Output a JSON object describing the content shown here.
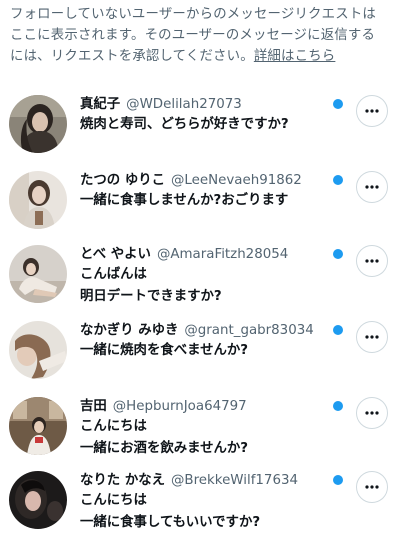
{
  "notice": {
    "line1": "フォローしていないユーザーからのメッセージリクエストは",
    "line2": "ここに表示されます。そのユーザーのメッセージに返信する",
    "line3": "には、リクエストを承認してください。",
    "link": "詳細はこちら"
  },
  "colors": {
    "unread_dot": "#1d9bf0",
    "secondary_text": "#536471"
  },
  "requests": [
    {
      "name": "真紀子",
      "handle": "@WDelilah27073",
      "messages": [
        "焼肉と寿司、どちらが好きですか?"
      ],
      "unread": true,
      "more_icon": "more-horizontal-icon",
      "avatar": "profile-photo"
    },
    {
      "name": "たつの ゆりこ",
      "handle": "@LeeNevaeh91862",
      "messages": [
        "一緒に食事しませんか?おごります"
      ],
      "unread": true,
      "more_icon": "more-horizontal-icon",
      "avatar": "profile-photo"
    },
    {
      "name": "とべ やよい",
      "handle": "@AmaraFitzh28054",
      "messages": [
        "こんばんは",
        "明日デートできますか?"
      ],
      "unread": true,
      "more_icon": "more-horizontal-icon",
      "avatar": "profile-photo"
    },
    {
      "name": "なかぎり みゆき",
      "handle": "@grant_gabr83034",
      "messages": [
        "一緒に焼肉を食べませんか?"
      ],
      "unread": true,
      "more_icon": "more-horizontal-icon",
      "avatar": "profile-photo"
    },
    {
      "name": "吉田",
      "handle": "@HepburnJoa64797",
      "messages": [
        "こんにちは",
        "一緒にお酒を飲みませんか?"
      ],
      "unread": true,
      "more_icon": "more-horizontal-icon",
      "avatar": "profile-photo"
    },
    {
      "name": "なりた かなえ",
      "handle": "@BrekkeWilf17634",
      "messages": [
        "こんにちは",
        "一緒に食事してもいいですか?"
      ],
      "unread": true,
      "more_icon": "more-horizontal-icon",
      "avatar": "profile-photo"
    }
  ]
}
